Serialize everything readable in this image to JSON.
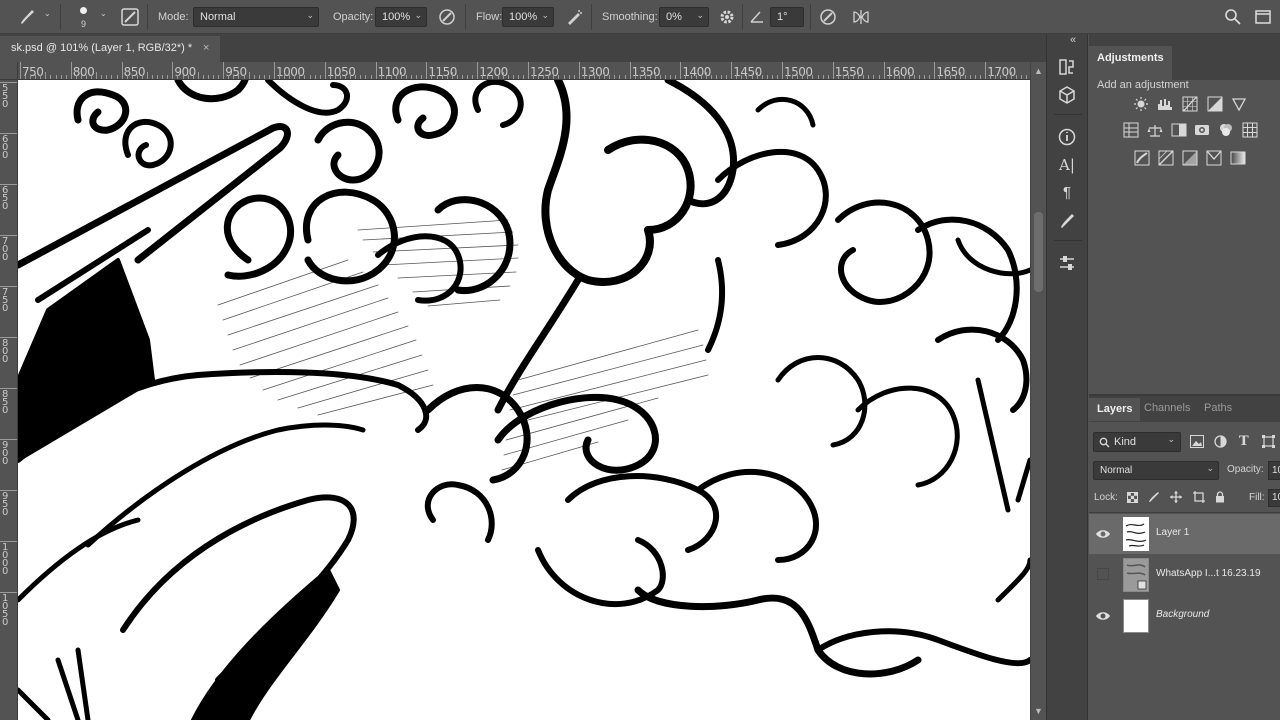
{
  "options_bar": {
    "brush_size": "9",
    "mode_label": "Mode:",
    "mode_value": "Normal",
    "opacity_label": "Opacity:",
    "opacity_value": "100%",
    "flow_label": "Flow:",
    "flow_value": "100%",
    "smoothing_label": "Smoothing:",
    "smoothing_value": "0%",
    "angle_value": "1°"
  },
  "document_tab": {
    "title": "sk.psd @ 101% (Layer 1, RGB/32*) *",
    "close": "×"
  },
  "ruler": {
    "horizontal_labels": [
      "750",
      "800",
      "850",
      "900",
      "950",
      "1000",
      "1050",
      "1100",
      "1150",
      "1200",
      "1250",
      "1300",
      "1350",
      "1400",
      "1450",
      "1500",
      "1550",
      "1600",
      "1650",
      "1700"
    ],
    "vertical_labels": [
      "5\n5\n0",
      "6\n0\n0",
      "6\n5\n0",
      "7\n0\n0",
      "7\n5\n0",
      "8\n0\n0",
      "8\n5\n0",
      "9\n0\n0",
      "9\n5\n0",
      "1\n0\n0\n0",
      "1\n0\n5\n0"
    ]
  },
  "adjustments_panel": {
    "tab_label": "Adjustments",
    "subtitle": "Add an adjustment"
  },
  "layers_panel": {
    "tabs": [
      "Layers",
      "Channels",
      "Paths"
    ],
    "filter_label": "Kind",
    "blend_mode": "Normal",
    "opacity_label": "Opacity:",
    "opacity_value": "10",
    "lock_label": "Lock:",
    "fill_label": "Fill:",
    "fill_value": "10",
    "layers": [
      {
        "name": "Layer 1",
        "visible": true,
        "selected": true,
        "italic": false
      },
      {
        "name": "WhatsApp I...t 16.23.19",
        "visible": false,
        "selected": false,
        "italic": false
      },
      {
        "name": "Background",
        "visible": true,
        "selected": false,
        "italic": true
      }
    ]
  },
  "colors": {
    "ui_bg": "#535353",
    "ui_dark": "#424242",
    "selected_row": "#6a6a6a",
    "canvas": "#ffffff",
    "ink": "#000000"
  }
}
